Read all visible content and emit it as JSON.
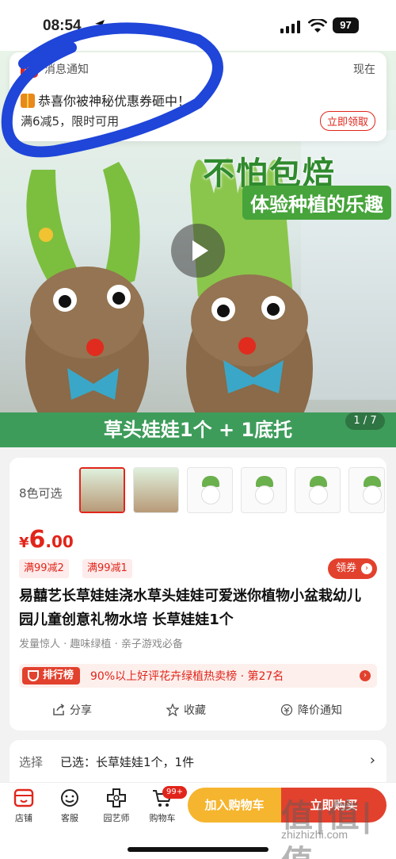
{
  "status_bar": {
    "time": "08:54",
    "battery": "97"
  },
  "notification": {
    "app_icon_label": "京东",
    "source": "消息通知",
    "time": "现在",
    "title": "恭喜你被神秘优惠券砸中！",
    "body": "满6减5，限时可用",
    "claim_label": "立即领取"
  },
  "hero": {
    "slogan_main": "不怕包焙",
    "slogan_sub": "体验种植的乐趣",
    "banner": "草头娃娃1个 + 1底托",
    "pager_current": "1",
    "pager_total": "7"
  },
  "product": {
    "colors_label": "8色可选",
    "price_symbol": "¥",
    "price_int": "6",
    "price_dec": ".00",
    "tags": [
      "满99减2",
      "满99减1"
    ],
    "coupon_label": "领券",
    "title": "易囍艺长草娃娃浇水草头娃娃可爱迷你植物小盆栽幼儿园儿童创意礼物水培 长草娃娃1个",
    "features": [
      "发量惊人",
      "趣味绿植",
      "亲子游戏必备"
    ],
    "rank_badge": "排行榜",
    "rank_text": "90%以上好评花卉绿植热卖榜 · 第27名",
    "actions": {
      "share": "分享",
      "favorite": "收藏",
      "price_alert": "降价通知"
    }
  },
  "selection": {
    "label": "选择",
    "value": "已选：长草娃娃1个，1件"
  },
  "bottom_bar": {
    "tabs": [
      "店铺",
      "客服",
      "园艺师",
      "购物车"
    ],
    "cart_badge": "99+",
    "add_to_cart": "加入购物车",
    "buy_now": "立即购买"
  },
  "watermark": {
    "logo": "值|值|值",
    "url": "zhizhizhi.com"
  },
  "colors": {
    "brand_red": "#e1251b",
    "cart_yellow": "#f6b52e",
    "banner_green": "#3e9c5a",
    "scribble_blue": "#1f45d9"
  }
}
